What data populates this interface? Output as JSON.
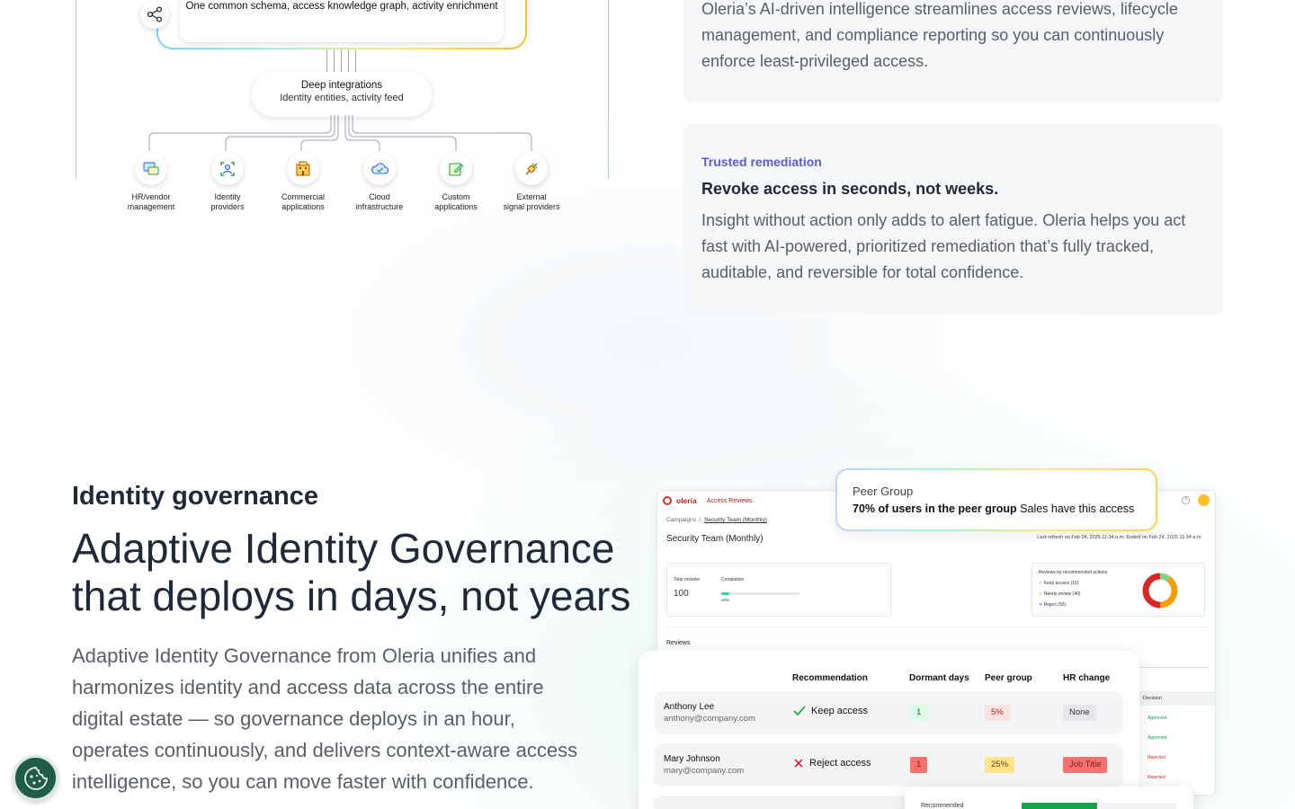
{
  "diagram": {
    "schema_text": "One common schema, access knowledge graph, activity enrichment",
    "deep_title": "Deep integrations",
    "deep_sub": "Identity entities, activity feed",
    "integrations": [
      {
        "line1": "HR/vendor",
        "line2": "management",
        "icon": "chat-icon"
      },
      {
        "line1": "Identity",
        "line2": "providers",
        "icon": "identity-icon"
      },
      {
        "line1": "Commercial",
        "line2": "applications",
        "icon": "building-icon"
      },
      {
        "line1": "Cloud",
        "line2": "infrastructure",
        "icon": "cloud-icon"
      },
      {
        "line1": "Custom",
        "line2": "applications",
        "icon": "edit-icon"
      },
      {
        "line1": "External",
        "line2": "signal providers",
        "icon": "plug-icon"
      }
    ]
  },
  "cards": {
    "card1_body": "Oleria’s AI-driven intelligence streamlines access reviews, lifecycle management, and compliance reporting so you can continuously enforce least-privileged access.",
    "card2_eyebrow": "Trusted remediation",
    "card2_title": "Revoke access in seconds, not weeks.",
    "card2_body": "Insight without action only adds to alert fatigue. Oleria helps you act fast with AI-powered, prioritized remediation that’s fully tracked, auditable, and reversible for total confidence."
  },
  "governance": {
    "eyebrow": "Identity governance",
    "title": "Adaptive Identity Governance that deploys in days, not years",
    "body": "Adaptive Identity Governance from Oleria unifies and harmonizes identity and access data across the entire digital estate — so governance deploys in an hour, operates continuously, and delivers context-aware access intelligence, so you can move faster with confidence."
  },
  "mockup": {
    "brand": "oleria",
    "nav": "Access Reviews",
    "help": "?",
    "crumb_root": "Campaigns",
    "crumb_sep": "/",
    "crumb_current": "Security Team (Monthly)",
    "title": "Security Team (Monthly)",
    "refresh": "Last refresh on Feb 24, 2025 11:34 a.m.   Ended on Feb 24, 2025 11:34 a.m.",
    "total_reviews_label": "Total reviews",
    "total_reviews": "100",
    "completion_label": "Completion",
    "completion_pct": "10%",
    "completion_fraction": 0.1,
    "recs_title": "Reviews by recommended actions",
    "recs": [
      "Keep access (10)",
      "Needs review (40)",
      "Reject (50)"
    ],
    "donut": [
      {
        "label": "Keep access",
        "value": 10,
        "color": "#86d08a"
      },
      {
        "label": "Needs review",
        "value": 40,
        "color": "#f59e0b"
      },
      {
        "label": "Reject",
        "value": 50,
        "color": "#dc2626"
      }
    ],
    "reviews_label": "Reviews",
    "decision_head": "Decision",
    "decisions": [
      "Approved",
      "Approved",
      "Rejected",
      "Rejected"
    ],
    "popover_label": "Peer Group",
    "popover_bold": "70% of users in the peer group",
    "popover_rest": " Sales have this access",
    "table_headers": [
      "Recommendation",
      "Dormant days",
      "Peer group",
      "HR change"
    ],
    "rows": [
      {
        "name": "Anthony Lee",
        "email": "anthony@company.com",
        "rec": "Keep access",
        "rec_icon": "check-icon",
        "dormant": "1",
        "peer": "5%",
        "hr": "None"
      },
      {
        "name": "Mary Johnson",
        "email": "mary@company.com",
        "rec": "Reject access",
        "rec_icon": "x-icon",
        "dormant": "1",
        "peer": "25%",
        "hr": "Job Title"
      }
    ],
    "bottom_label": "Recommended"
  },
  "colors": {
    "accent": "#5b5bd6",
    "cookie": "#1f5c4a"
  }
}
